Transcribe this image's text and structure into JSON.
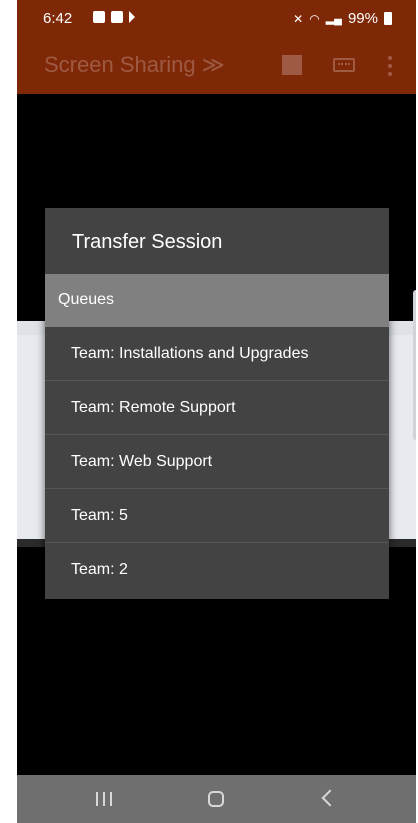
{
  "status_bar": {
    "time": "6:42",
    "battery": "99%",
    "icons": [
      "image-icon",
      "close-box-icon",
      "cast-icon",
      "mute-icon",
      "wifi-icon",
      "signal-icon",
      "battery-charging-icon"
    ]
  },
  "app_bar": {
    "title": "Screen Sharing",
    "title_icon": "double-chevron-right-icon",
    "actions": [
      "stop-icon",
      "keyboard-icon",
      "more-vert-icon"
    ],
    "color": "#7f2808"
  },
  "dialog": {
    "title": "Transfer Session",
    "section_header": "Queues",
    "items": [
      {
        "label": "Team: Installations and Upgrades"
      },
      {
        "label": "Team: Remote Support"
      },
      {
        "label": "Team: Web Support"
      },
      {
        "label": "Team: 5"
      },
      {
        "label": "Team: 2"
      }
    ]
  },
  "nav_bar": {
    "buttons": [
      "recent-apps-icon",
      "home-icon",
      "back-icon"
    ]
  }
}
